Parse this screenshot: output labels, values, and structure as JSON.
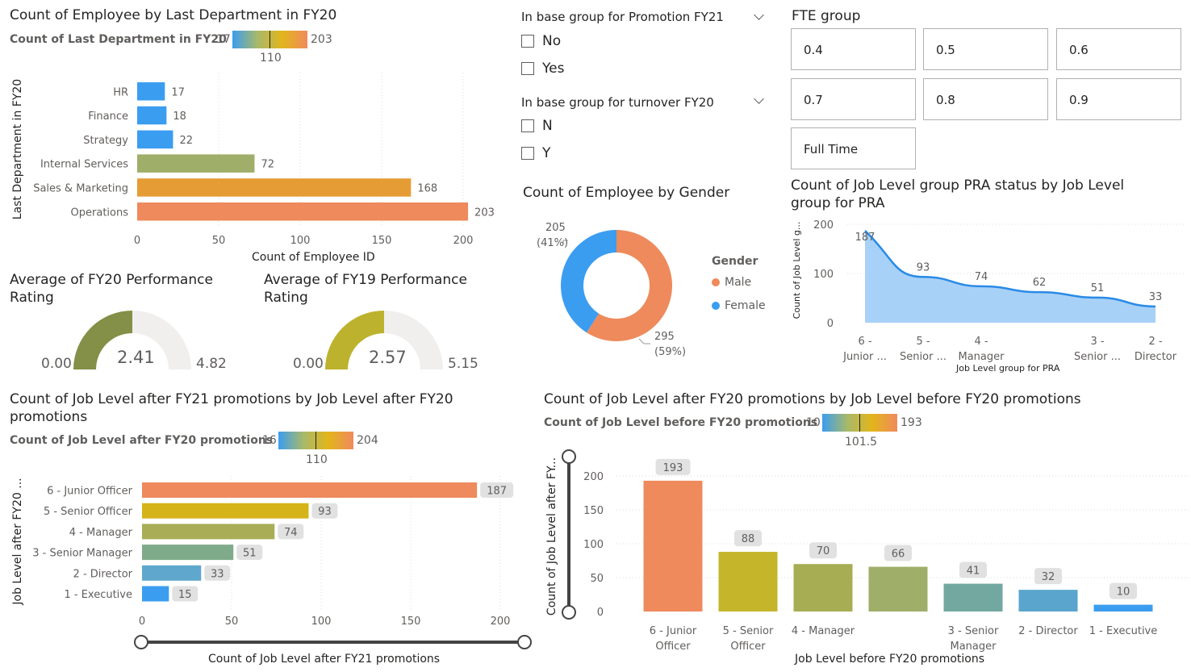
{
  "dept_chart": {
    "title": "Count of Employee by Last Department in FY20",
    "legend_title": "Count of Last Department in FY20",
    "legend_min": "17",
    "legend_mid": "110",
    "legend_max": "203",
    "xlabel": "Count of Employee ID",
    "ylabel": "Last Department in FY20",
    "x_ticks": [
      "0",
      "50",
      "100",
      "150",
      "200"
    ],
    "colors": [
      "#3b9df0",
      "#3b9df0",
      "#3b9df0",
      "#9fae68",
      "#e59c35",
      "#ee8a5c"
    ]
  },
  "gauge1": {
    "title_line1": "Average of FY20 Performance",
    "title_line2": "Rating",
    "min": "0.00",
    "max": "4.82",
    "value": "2.41",
    "color": "#848f47"
  },
  "gauge2": {
    "title_line1": "Average of FY19 Performance",
    "title_line2": "Rating",
    "min": "0.00",
    "max": "5.15",
    "value": "2.57",
    "color": "#bcb22d"
  },
  "slicer_promo": {
    "title": "In base group for Promotion FY21",
    "options": [
      "No",
      "Yes"
    ]
  },
  "slicer_turnover": {
    "title": "In base group for turnover FY20",
    "options": [
      "N",
      "Y"
    ]
  },
  "fte": {
    "title": "FTE group",
    "tiles": [
      "0.4",
      "0.5",
      "0.6",
      "0.7",
      "0.8",
      "0.9",
      "Full Time"
    ]
  },
  "gender_chart": {
    "title": "Count of Employee by Gender",
    "legend_title": "Gender",
    "female_value": "205",
    "female_pct": "(41%)",
    "male_value": "295",
    "male_pct": "(59%)"
  },
  "pra_chart": {
    "title_line1": "Count of Job Level group PRA status by Job Level",
    "title_line2": "group for PRA",
    "ylabel": "Count of Job Level g...",
    "xlabel": "Job Level group for PRA",
    "y_ticks": [
      "200",
      "100",
      "0"
    ],
    "cat_line1": [
      "6 -",
      "5 -",
      "4 -",
      "3 -",
      "2 -"
    ],
    "cat_line2": [
      "Junior ...",
      "Senior ...",
      "Manager",
      "Senior ...",
      "Director"
    ]
  },
  "fy21_chart": {
    "title_line1": "Count of Job Level after FY21 promotions by Job Level after FY20",
    "title_line2": "promotions",
    "legend_title": "Count of Job Level after FY20 promotions",
    "legend_min": "16",
    "legend_mid": "110",
    "legend_max": "204",
    "ylabel": "Job Level after FY20 ...",
    "xlabel": "Count of Job Level after FY21 promotions",
    "x_ticks": [
      "0",
      "50",
      "100",
      "150",
      "200"
    ],
    "colors": [
      "#ee8a5c",
      "#d4b419",
      "#a8ad56",
      "#80ab8b",
      "#5fa7cd",
      "#3b9df0"
    ]
  },
  "fy20_chart": {
    "title": "Count of Job Level after FY20 promotions by Job Level before FY20 promotions",
    "legend_title": "Count of Job Level before FY20 promotions",
    "legend_min": "10",
    "legend_mid": "101.5",
    "legend_max": "193",
    "ylabel": "Count of Job Level after FY...",
    "xlabel": "Job Level before FY20 promotions",
    "y_ticks": [
      "200",
      "150",
      "100",
      "50",
      "0"
    ],
    "cat_line1": [
      "6 - Junior",
      "5 - Senior",
      "4 - Manager",
      "",
      "3 - Senior",
      "2 - Director",
      "1 - Executive"
    ],
    "cat_line2": [
      "Officer",
      "Officer",
      "",
      "",
      "Manager",
      "",
      ""
    ],
    "colors": [
      "#ee8a5c",
      "#c4b52b",
      "#a7ad52",
      "#9fae68",
      "#72a8a0",
      "#5aa5cd",
      "#3b9df0"
    ]
  },
  "chart_data": [
    {
      "type": "bar",
      "title": "Count of Employee by Last Department in FY20",
      "xlabel": "Count of Employee ID",
      "ylabel": "Last Department in FY20",
      "categories": [
        "HR",
        "Finance",
        "Strategy",
        "Internal Services",
        "Sales & Marketing",
        "Operations"
      ],
      "values": [
        17,
        18,
        22,
        72,
        168,
        203
      ],
      "xlim": [
        0,
        210
      ]
    },
    {
      "type": "pie",
      "title": "Count of Employee by Gender",
      "categories": [
        "Male",
        "Female"
      ],
      "values": [
        295,
        205
      ]
    },
    {
      "type": "area",
      "title": "Count of Job Level group PRA status by Job Level group for PRA",
      "xlabel": "Job Level group for PRA",
      "ylabel": "Count of Job Level g...",
      "categories": [
        "6 - Junior ...",
        "5 - Senior ...",
        "4 - Manager",
        "",
        "3 - Senior ...",
        "2 - Director"
      ],
      "values": [
        187,
        93,
        74,
        62,
        51,
        33
      ],
      "ylim": [
        0,
        200
      ]
    },
    {
      "type": "bar",
      "title": "Count of Job Level after FY21 promotions by Job Level after FY20 promotions",
      "xlabel": "Count of Job Level after FY21 promotions",
      "ylabel": "Job Level after FY20 ...",
      "categories": [
        "6 - Junior Officer",
        "5 - Senior Officer",
        "4 - Manager",
        "3 - Senior Manager",
        "2 - Director",
        "1 - Executive"
      ],
      "values": [
        187,
        93,
        74,
        51,
        33,
        15
      ],
      "xlim": [
        0,
        205
      ]
    },
    {
      "type": "bar",
      "title": "Count of Job Level after FY20 promotions by Job Level before FY20 promotions",
      "xlabel": "Job Level before FY20 promotions",
      "ylabel": "Count of Job Level after FY...",
      "categories": [
        "6 - Junior Officer",
        "5 - Senior Officer",
        "4 - Manager",
        "",
        "3 - Senior Manager",
        "2 - Director",
        "1 - Executive"
      ],
      "values": [
        193,
        88,
        70,
        66,
        41,
        32,
        10
      ],
      "ylim": [
        0,
        210
      ]
    }
  ]
}
